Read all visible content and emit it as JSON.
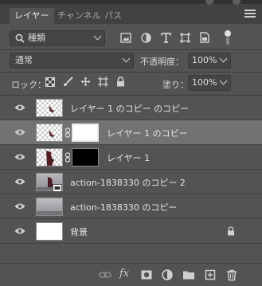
{
  "tabs": [
    {
      "label": "レイヤー"
    },
    {
      "label": "チャンネル"
    },
    {
      "label": "パス"
    }
  ],
  "filter": {
    "kind_label": "種類",
    "icons": [
      "pixel-filter-icon",
      "adjustment-filter-icon",
      "type-filter-icon",
      "shape-filter-icon",
      "smart-object-filter-icon",
      "filter-toggle-icon"
    ]
  },
  "blend": {
    "mode_value": "通常",
    "opacity_label": "不透明度：",
    "opacity_value": "100%"
  },
  "lock": {
    "label": "ロック：",
    "icons": [
      "lock-transparent-icon",
      "lock-paint-icon",
      "lock-position-icon",
      "lock-artboard-icon",
      "lock-all-icon"
    ],
    "fill_label": "塗り：",
    "fill_value": "100%"
  },
  "layers": [
    {
      "name": "レイヤー 1 のコピー のコピー",
      "visible": true,
      "selected": false,
      "has_mask": false
    },
    {
      "name": "レイヤー 1 のコピー",
      "visible": true,
      "selected": true,
      "has_mask": true,
      "mask": "white"
    },
    {
      "name": "レイヤー 1",
      "visible": true,
      "selected": false,
      "has_mask": true,
      "mask": "black"
    },
    {
      "name": "action-1838330 のコピー 2",
      "visible": true,
      "selected": false,
      "has_mask": false
    },
    {
      "name": "action-1838330 のコピー",
      "visible": true,
      "selected": false,
      "has_mask": false
    },
    {
      "name": "背景",
      "visible": true,
      "selected": false,
      "has_mask": false,
      "locked": true
    }
  ],
  "footer": {
    "fx_label": "fx",
    "icons": [
      "link-layers-icon",
      "fx-icon",
      "add-mask-icon",
      "adjustment-layer-icon",
      "new-group-icon",
      "new-layer-icon",
      "delete-layer-icon"
    ]
  }
}
